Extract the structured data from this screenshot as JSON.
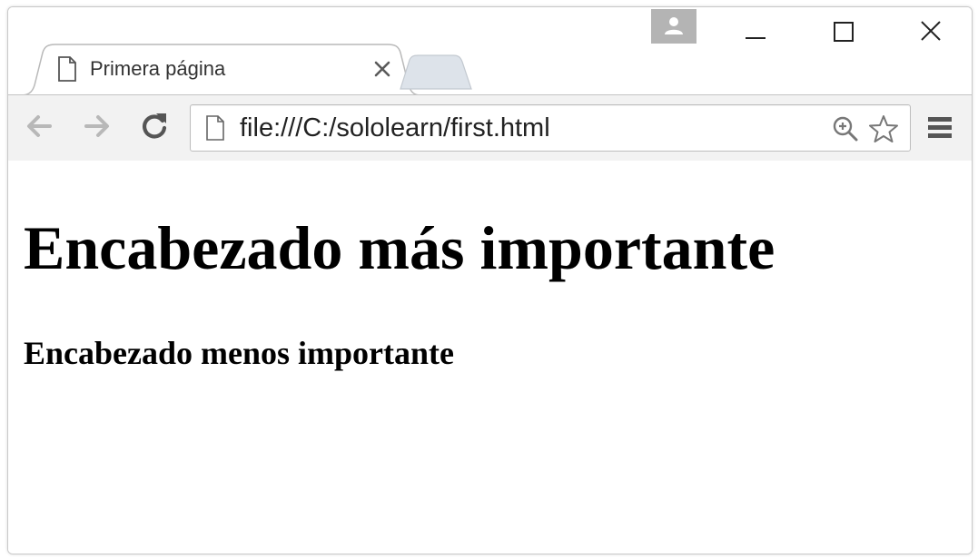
{
  "browser": {
    "tab": {
      "title": "Primera página",
      "icon": "document-icon",
      "close_icon": "close-icon"
    },
    "new_tab_icon": "new-tab-icon",
    "profile_icon": "person-icon",
    "window_controls": {
      "minimize_icon": "minimize-icon",
      "maximize_icon": "maximize-icon",
      "close_icon": "close-icon"
    },
    "toolbar": {
      "back_icon": "back-arrow-icon",
      "forward_icon": "forward-arrow-icon",
      "reload_icon": "reload-icon",
      "url": "file:///C:/sololearn/first.html",
      "zoom_icon": "zoom-in-icon",
      "bookmark_icon": "star-icon",
      "menu_icon": "hamburger-menu-icon"
    },
    "colors": {
      "chrome_bg": "#f2f2f2",
      "profile_bg": "#b4b4b4",
      "tab_inactive": "#dde3ea"
    }
  },
  "page": {
    "heading_1": "Encabezado más importante",
    "heading_2": "Encabezado menos importante"
  }
}
